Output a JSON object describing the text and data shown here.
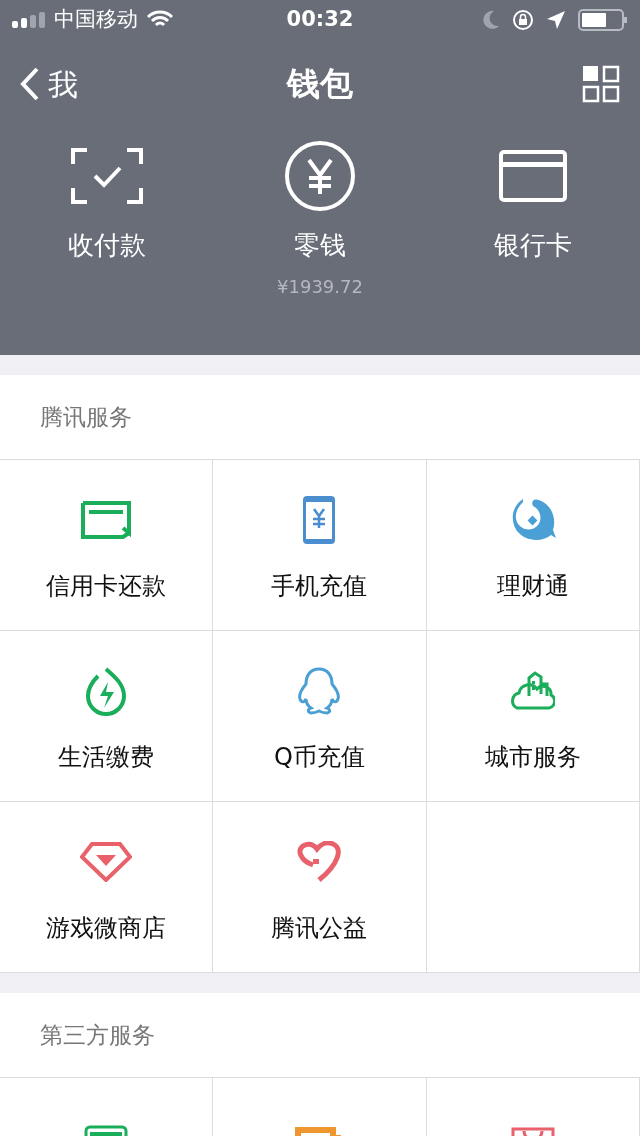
{
  "status_bar": {
    "carrier": "中国移动",
    "time": "00:32"
  },
  "nav": {
    "back": "我",
    "title": "钱包"
  },
  "actions": [
    {
      "kind": "scan",
      "label": "收付款"
    },
    {
      "kind": "yuan",
      "label": "零钱",
      "sub": "¥1939.72"
    },
    {
      "kind": "card",
      "label": "银行卡"
    }
  ],
  "sections": [
    {
      "title": "腾讯服务",
      "items": [
        {
          "kind": "credit",
          "label": "信用卡还款"
        },
        {
          "kind": "phone",
          "label": "手机充值"
        },
        {
          "kind": "fish",
          "label": "理财通"
        },
        {
          "kind": "bolt",
          "label": "生活缴费"
        },
        {
          "kind": "penguin",
          "label": "Q币充值"
        },
        {
          "kind": "city",
          "label": "城市服务"
        },
        {
          "kind": "diamond",
          "label": "游戏微商店"
        },
        {
          "kind": "heart",
          "label": "腾讯公益"
        }
      ]
    },
    {
      "title": "第三方服务",
      "items": [
        {
          "kind": "greencard"
        },
        {
          "kind": "orangebox"
        },
        {
          "kind": "bag"
        }
      ]
    }
  ]
}
